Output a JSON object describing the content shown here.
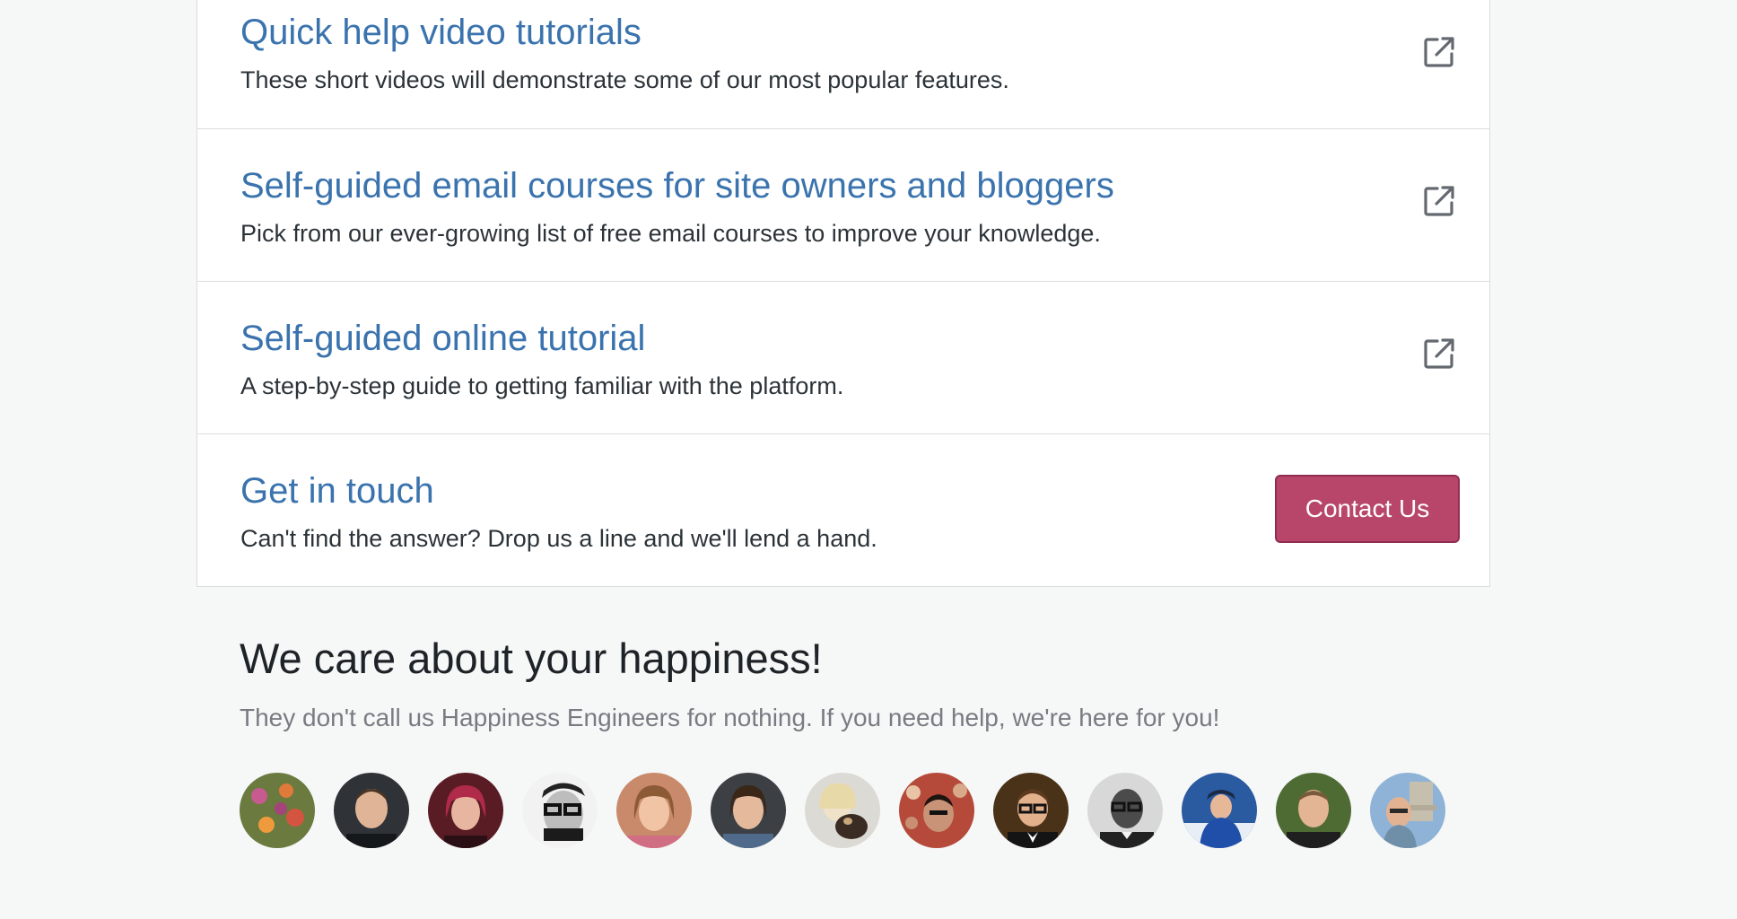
{
  "cards": [
    {
      "title": "Quick help video tutorials",
      "description": "These short videos will demonstrate some of our most popular features.",
      "icon": "external-link-icon"
    },
    {
      "title": "Self-guided email courses for site owners and bloggers",
      "description": "Pick from our ever-growing list of free email courses to improve your knowledge.",
      "icon": "external-link-icon"
    },
    {
      "title": "Self-guided online tutorial",
      "description": "A step-by-step guide to getting familiar with the platform.",
      "icon": "external-link-icon"
    },
    {
      "title": "Get in touch",
      "description": "Can't find the answer? Drop us a line and we'll lend a hand.",
      "button_label": "Contact Us"
    }
  ],
  "happiness": {
    "title": "We care about your happiness!",
    "description": "They don't call us Happiness Engineers for nothing. If you need help, we're here for you!"
  },
  "colors": {
    "link": "#3a73ad",
    "button": "#b8466a",
    "text": "#2c3338",
    "muted": "#787c82",
    "background": "#f6f7f7"
  }
}
